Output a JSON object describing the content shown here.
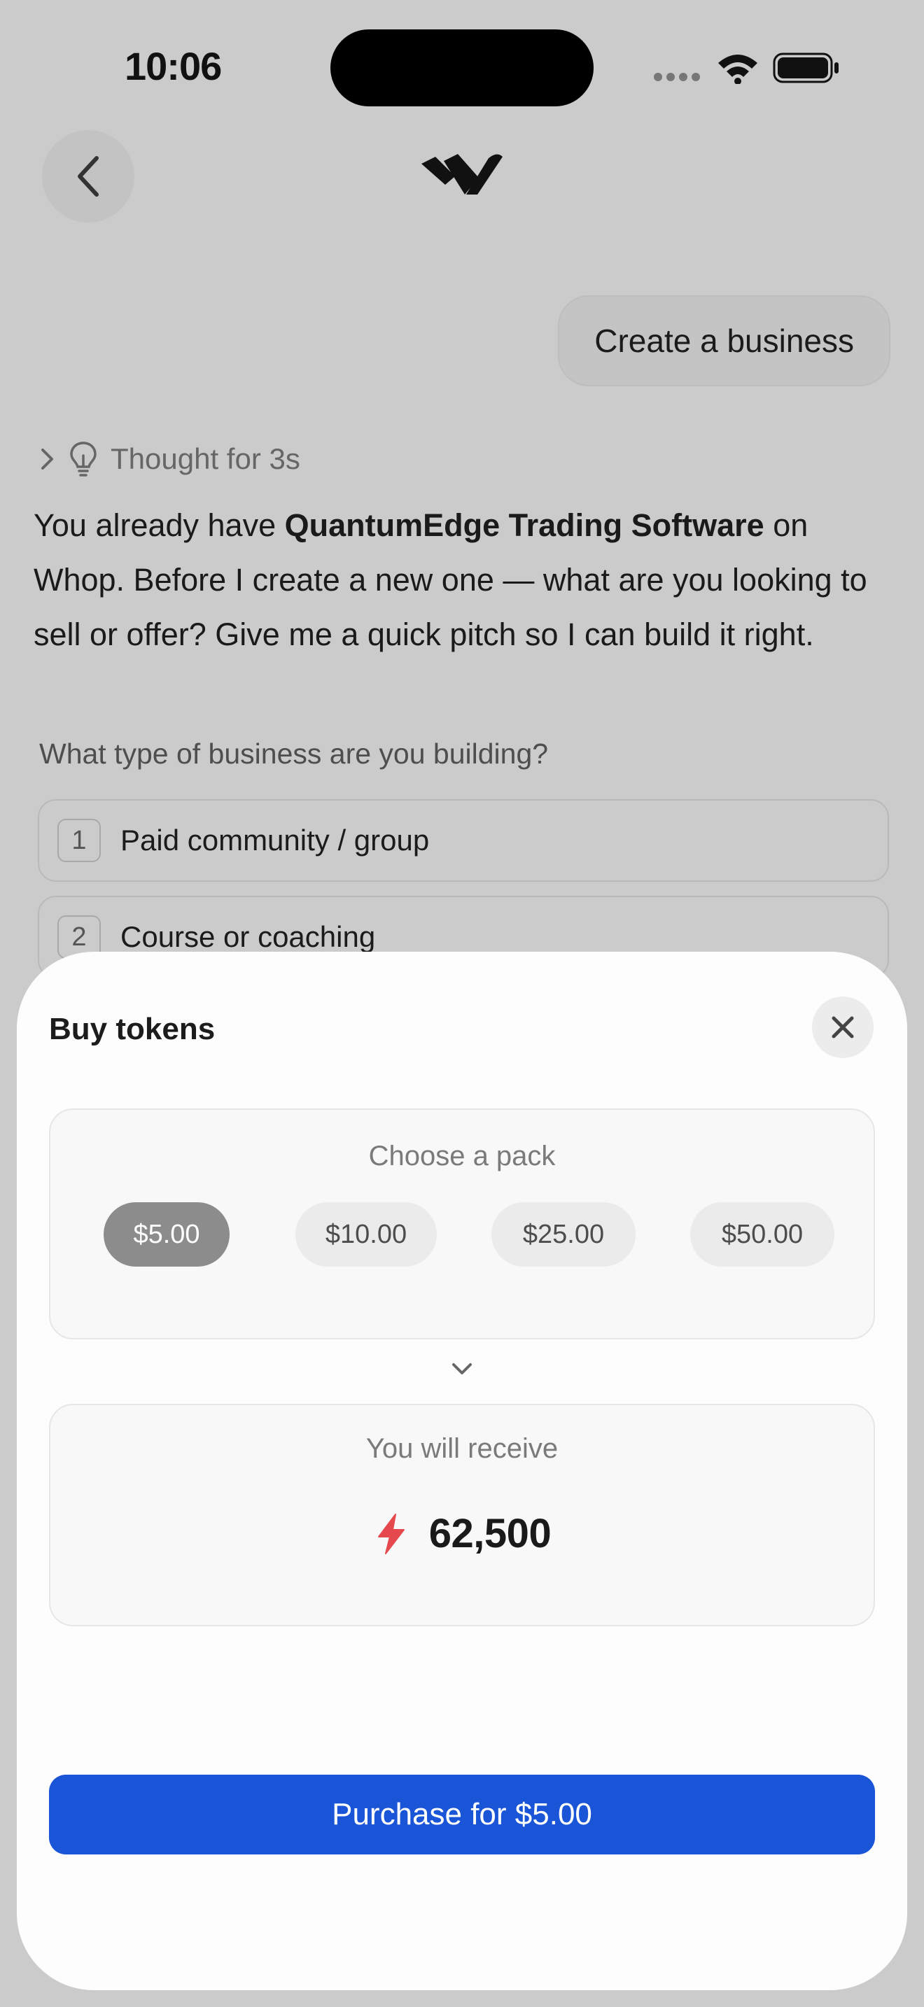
{
  "status_bar": {
    "time": "10:06"
  },
  "chat": {
    "user_message": "Create a business",
    "thought_label": "Thought for 3s",
    "assistant_message": {
      "before": "You already have ",
      "bold": "QuantumEdge Trading Software",
      "after": " on Whop. Before I create a new one — what are you looking to sell or offer? Give me a quick pitch so I can build it right."
    },
    "question": "What type of business are you building?",
    "options": [
      {
        "number": "1",
        "label": "Paid community / group"
      },
      {
        "number": "2",
        "label": "Course or coaching"
      }
    ]
  },
  "sheet": {
    "title": "Buy tokens",
    "pack_label": "Choose a pack",
    "packs": [
      {
        "label": "$5.00",
        "selected": true
      },
      {
        "label": "$10.00",
        "selected": false
      },
      {
        "label": "$25.00",
        "selected": false
      },
      {
        "label": "$50.00",
        "selected": false
      }
    ],
    "receive_label": "You will receive",
    "receive_amount": "62,500",
    "purchase_label": "Purchase for $5.00"
  },
  "colors": {
    "accent_blue": "#1a55d8",
    "token_icon": "#e5484d",
    "selected_pill": "#8c8c8c",
    "overlay_bg": "#cbcbcb"
  },
  "icons": {
    "back": "chevron-left-icon",
    "logo": "whop-logo",
    "thought_expand": "chevron-right-icon",
    "thought": "lightbulb-icon",
    "close": "close-icon",
    "divider": "chevron-down-icon",
    "token": "lightning-icon",
    "wifi": "wifi-icon",
    "battery": "battery-icon"
  }
}
